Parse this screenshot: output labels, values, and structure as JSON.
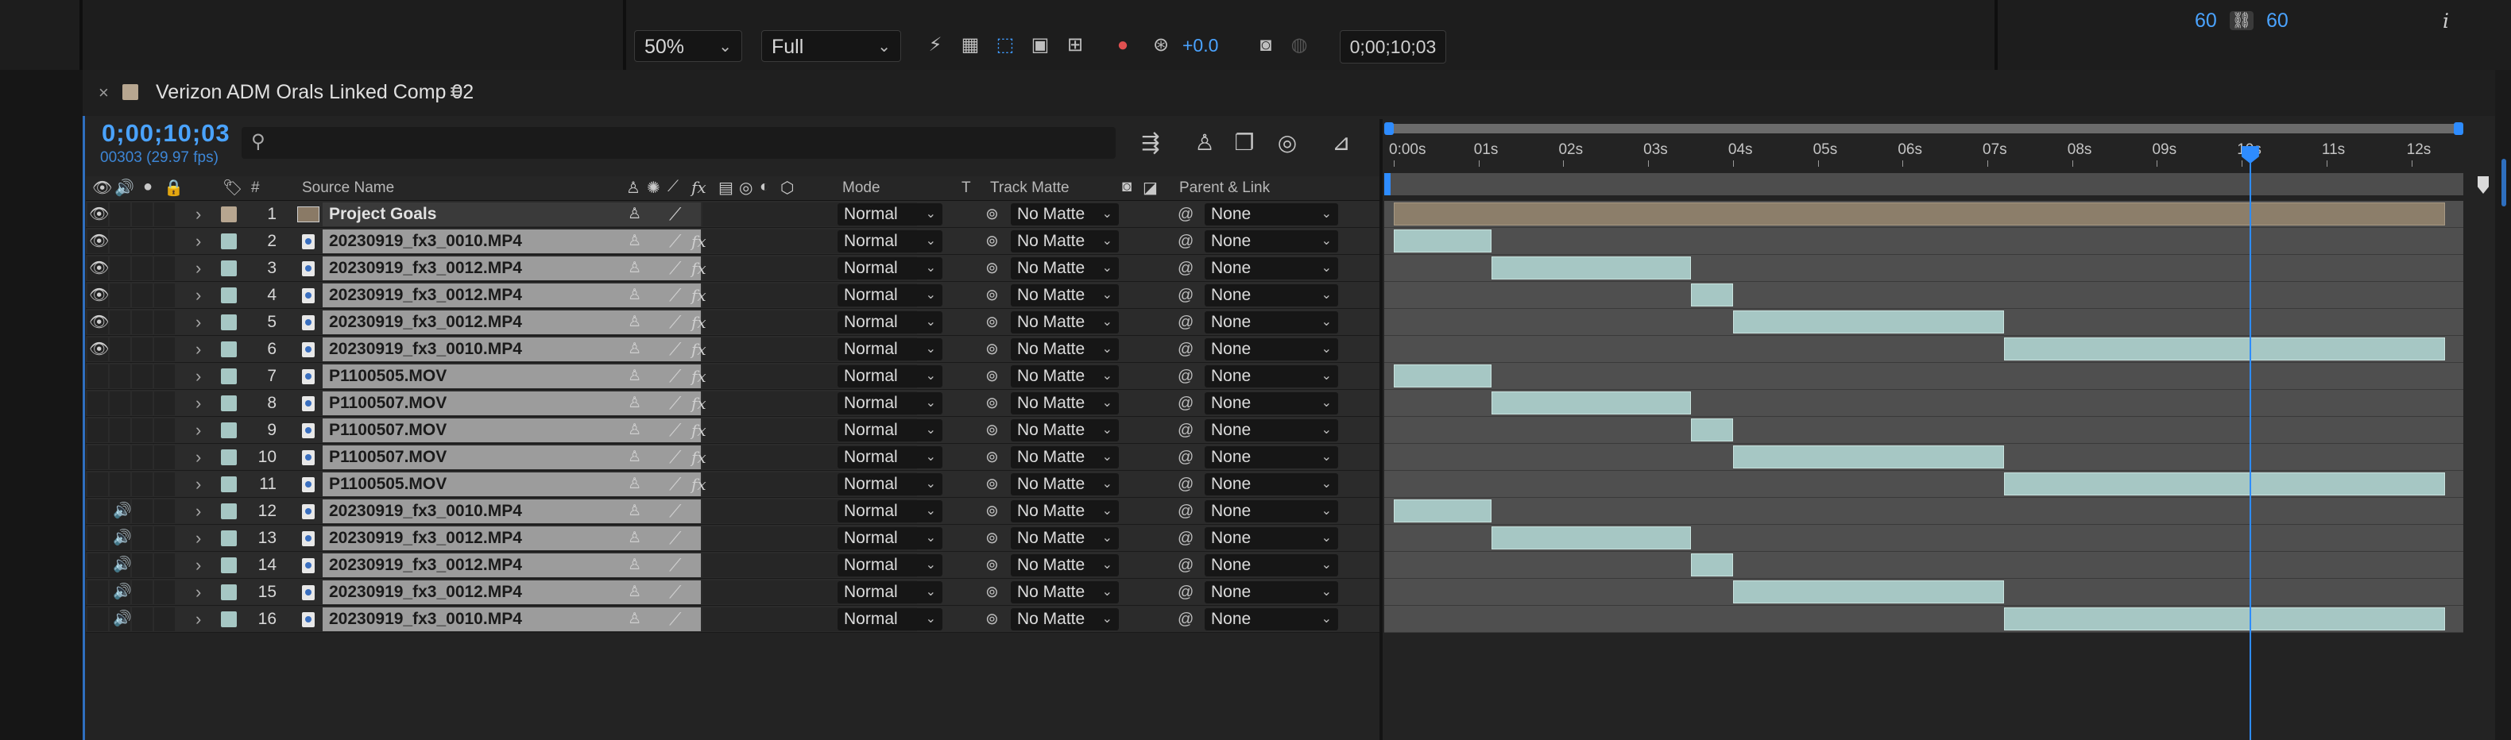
{
  "viewer_toolbar": {
    "zoom": "50%",
    "resolution": "Full",
    "exposure": "+0.0",
    "current_time": "0;00;10;03",
    "right_values": [
      "60",
      "60"
    ],
    "info_glyph": "i"
  },
  "panel": {
    "comp_name": "Verizon ADM Orals Linked Comp 02",
    "close": "×",
    "menu": "≡",
    "timecode": "0;00;10;03",
    "frames": "00303 (29.97 fps)"
  },
  "columns": {
    "num": "#",
    "source": "Source Name",
    "mode": "Mode",
    "t": "T",
    "track_matte": "Track Matte",
    "parent": "Parent & Link"
  },
  "ruler": {
    "labels": [
      "0:00s",
      "01s",
      "02s",
      "03s",
      "04s",
      "05s",
      "06s",
      "07s",
      "08s",
      "09s",
      "10s",
      "11s",
      "12s"
    ],
    "duration_seconds": 12.5,
    "current_seconds": 10.1
  },
  "layers": [
    {
      "num": "1",
      "name": "Project Goals",
      "type": "comp",
      "eye": true,
      "audio": false,
      "fx": false,
      "mode": "Normal",
      "matte": "No Matte",
      "parent": "None",
      "in": 0.0,
      "out": 12.4
    },
    {
      "num": "2",
      "name": "20230919_fx3_0010.MP4",
      "type": "video",
      "eye": true,
      "audio": false,
      "fx": true,
      "mode": "Normal",
      "matte": "No Matte",
      "parent": "None",
      "in": 0.0,
      "out": 1.15
    },
    {
      "num": "3",
      "name": "20230919_fx3_0012.MP4",
      "type": "video",
      "eye": true,
      "audio": false,
      "fx": true,
      "mode": "Normal",
      "matte": "No Matte",
      "parent": "None",
      "in": 1.15,
      "out": 3.5
    },
    {
      "num": "4",
      "name": "20230919_fx3_0012.MP4",
      "type": "video",
      "eye": true,
      "audio": false,
      "fx": true,
      "mode": "Normal",
      "matte": "No Matte",
      "parent": "None",
      "in": 3.5,
      "out": 4.0
    },
    {
      "num": "5",
      "name": "20230919_fx3_0012.MP4",
      "type": "video",
      "eye": true,
      "audio": false,
      "fx": true,
      "mode": "Normal",
      "matte": "No Matte",
      "parent": "None",
      "in": 4.0,
      "out": 7.2
    },
    {
      "num": "6",
      "name": "20230919_fx3_0010.MP4",
      "type": "video",
      "eye": true,
      "audio": false,
      "fx": true,
      "mode": "Normal",
      "matte": "No Matte",
      "parent": "None",
      "in": 7.2,
      "out": 12.4
    },
    {
      "num": "7",
      "name": "P1100505.MOV",
      "type": "video",
      "eye": false,
      "audio": false,
      "fx": true,
      "mode": "Normal",
      "matte": "No Matte",
      "parent": "None",
      "in": 0.0,
      "out": 1.15
    },
    {
      "num": "8",
      "name": "P1100507.MOV",
      "type": "video",
      "eye": false,
      "audio": false,
      "fx": true,
      "mode": "Normal",
      "matte": "No Matte",
      "parent": "None",
      "in": 1.15,
      "out": 3.5
    },
    {
      "num": "9",
      "name": "P1100507.MOV",
      "type": "video",
      "eye": false,
      "audio": false,
      "fx": true,
      "mode": "Normal",
      "matte": "No Matte",
      "parent": "None",
      "in": 3.5,
      "out": 4.0
    },
    {
      "num": "10",
      "name": "P1100507.MOV",
      "type": "video",
      "eye": false,
      "audio": false,
      "fx": true,
      "mode": "Normal",
      "matte": "No Matte",
      "parent": "None",
      "in": 4.0,
      "out": 7.2
    },
    {
      "num": "11",
      "name": "P1100505.MOV",
      "type": "video",
      "eye": false,
      "audio": false,
      "fx": true,
      "mode": "Normal",
      "matte": "No Matte",
      "parent": "None",
      "in": 7.2,
      "out": 12.4
    },
    {
      "num": "12",
      "name": "20230919_fx3_0010.MP4",
      "type": "video",
      "eye": false,
      "audio": true,
      "fx": false,
      "mode": "Normal",
      "matte": "No Matte",
      "parent": "None",
      "in": 0.0,
      "out": 1.15
    },
    {
      "num": "13",
      "name": "20230919_fx3_0012.MP4",
      "type": "video",
      "eye": false,
      "audio": true,
      "fx": false,
      "mode": "Normal",
      "matte": "No Matte",
      "parent": "None",
      "in": 1.15,
      "out": 3.5
    },
    {
      "num": "14",
      "name": "20230919_fx3_0012.MP4",
      "type": "video",
      "eye": false,
      "audio": true,
      "fx": false,
      "mode": "Normal",
      "matte": "No Matte",
      "parent": "None",
      "in": 3.5,
      "out": 4.0
    },
    {
      "num": "15",
      "name": "20230919_fx3_0012.MP4",
      "type": "video",
      "eye": false,
      "audio": true,
      "fx": false,
      "mode": "Normal",
      "matte": "No Matte",
      "parent": "None",
      "in": 4.0,
      "out": 7.2
    },
    {
      "num": "16",
      "name": "20230919_fx3_0010.MP4",
      "type": "video",
      "eye": false,
      "audio": true,
      "fx": false,
      "mode": "Normal",
      "matte": "No Matte",
      "parent": "None",
      "in": 7.2,
      "out": 12.4
    }
  ],
  "colors": {
    "accent": "#2e8cff",
    "label_comp": "#b7a690",
    "label_video": "#a6c7c4",
    "bar_video": "#a6c7c4",
    "bar_comp": "#8c7e6a"
  }
}
